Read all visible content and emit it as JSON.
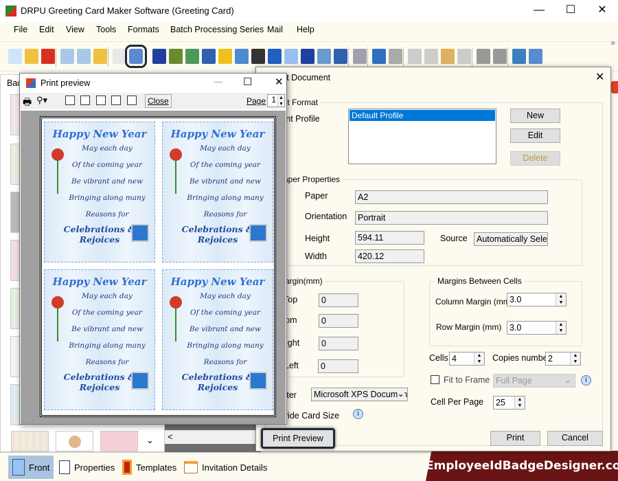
{
  "app": {
    "title": "DRPU Greeting Card Maker Software (Greeting Card)",
    "minimize": "—",
    "maximize": "☐",
    "close": "✕"
  },
  "menu": [
    "File",
    "Edit",
    "View",
    "Tools",
    "Formats",
    "Batch Processing Series",
    "Mail",
    "Help"
  ],
  "toolbar": {
    "icons": [
      "new-icon",
      "open-icon",
      "close-file-icon",
      "save-icon",
      "save-as-icon",
      "export-icon",
      "properties-icon",
      "print-icon",
      "background-icon",
      "card-icon",
      "image-icon",
      "pen-icon",
      "shapes-icon",
      "watermark-icon",
      "barcode-icon",
      "text-icon",
      "word-art-icon",
      "signature-icon",
      "email-icon",
      "line-icon",
      "database-icon",
      "undo-icon",
      "redo-icon",
      "cut-icon",
      "copy-icon",
      "paste-icon",
      "delete-icon",
      "bring-front-icon",
      "send-back-icon",
      "grid-icon",
      "actual-size-icon"
    ],
    "overflow": "»",
    "active": "print-icon"
  },
  "left_panel": {
    "title": "Backgrounds",
    "scroll_down": "⌄",
    "scroll_left": "<"
  },
  "bottom_tabs": [
    {
      "label": "Front",
      "icon": "front-icon",
      "active": true
    },
    {
      "label": "Properties",
      "icon": "properties-icon"
    },
    {
      "label": "Templates",
      "icon": "templates-icon"
    },
    {
      "label": "Invitation Details",
      "icon": "invitation-details-icon"
    }
  ],
  "brand": "EmployeeIdBadgeDesigner.com",
  "preview": {
    "title": "Print preview",
    "close_label": "Close",
    "page_label": "Page",
    "page_value": "1",
    "minimize": "—",
    "maximize": "☐",
    "close": "✕",
    "card": {
      "heading": "Happy New Year",
      "lines": [
        "May each day",
        "Of the coming year",
        "Be vibrant and new",
        "Bringing along many",
        "Reasons for"
      ],
      "footer": "Celebrations & Rejoices"
    }
  },
  "dialog": {
    "title": "Print Document",
    "close": "✕",
    "print_format": "Print Format",
    "print_profile_label": "Print Profile",
    "profiles": [
      "Default Profile"
    ],
    "new": "New",
    "edit": "Edit",
    "delete": "Delete",
    "paper_properties": "Paper Properties",
    "paper_label": "Paper",
    "paper": "A2",
    "orientation_label": "Orientation",
    "orientation": "Portrait",
    "height_label": "Height",
    "height": "594.11",
    "width_label": "Width",
    "width": "420.12",
    "source_label": "Source",
    "source": "Automatically Select",
    "margin": "Margin(mm)",
    "top_label": "Top",
    "top": "0",
    "bottom_label": "Bottom",
    "bottom": "0",
    "right_label": "Right",
    "right": "0",
    "left_label": "Left",
    "left": "0",
    "cells_margins": "Margins Between Cells",
    "column_margin_label": "Column Margin (mm)",
    "column_margin": "3.0",
    "row_margin_label": "Row Margin (mm)",
    "row_margin": "3.0",
    "cells_label": "Cells",
    "cells": "4",
    "copies_label": "Copies number",
    "copies": "2",
    "fit_to_frame": "Fit to Frame",
    "fit_to_frame_checked": false,
    "frame_option": "Full Page",
    "cell_per_page_label": "Cell Per Page",
    "cell_per_page": "25",
    "printer_label": "Printer",
    "printer": "Microsoft XPS Document Writer",
    "divide_card_size": "Divide Card Size",
    "print_preview": "Print Preview",
    "print": "Print",
    "cancel": "Cancel"
  },
  "colors": {
    "selection": "#0078d7",
    "brand_bg": "#6b1414",
    "delete_text": "#b8a040"
  }
}
